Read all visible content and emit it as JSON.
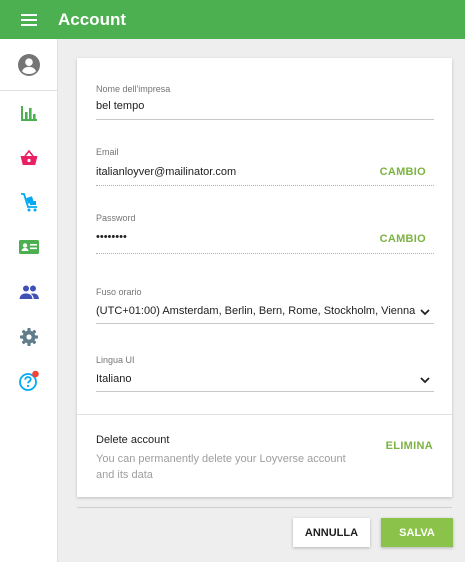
{
  "header": {
    "title": "Account"
  },
  "sidebar": {
    "items": [
      {
        "icon": "account-circle-icon",
        "color": "#757575"
      },
      {
        "icon": "bar-chart-icon",
        "color": "#4caf50"
      },
      {
        "icon": "basket-icon",
        "color": "#e91e63"
      },
      {
        "icon": "items-cart-icon",
        "color": "#03a9f4"
      },
      {
        "icon": "customer-card-icon",
        "color": "#4caf50"
      },
      {
        "icon": "employees-icon",
        "color": "#3f51b5"
      },
      {
        "icon": "settings-gear-icon",
        "color": "#607d8b"
      },
      {
        "icon": "help-icon",
        "color": "#03a9f4"
      }
    ]
  },
  "form": {
    "business_name": {
      "label": "Nome dell'impresa",
      "value": "bel tempo"
    },
    "email": {
      "label": "Email",
      "value": "italianloyver@mailinator.com",
      "action": "CAMBIO"
    },
    "password": {
      "label": "Password",
      "value": "••••••••",
      "action": "CAMBIO"
    },
    "timezone": {
      "label": "Fuso orario",
      "value": "(UTC+01:00) Amsterdam, Berlin, Bern, Rome, Stockholm, Vienna"
    },
    "language": {
      "label": "Lingua UI",
      "value": "Italiano"
    }
  },
  "delete_account": {
    "title": "Delete account",
    "description": "You can permanently delete your Loyverse account and its data",
    "action": "ELIMINA"
  },
  "footer": {
    "cancel_label": "ANNULLA",
    "save_label": "SALVA"
  },
  "colors": {
    "primary": "#4caf50",
    "accent": "#8bc34a",
    "notification": "#f44336"
  }
}
